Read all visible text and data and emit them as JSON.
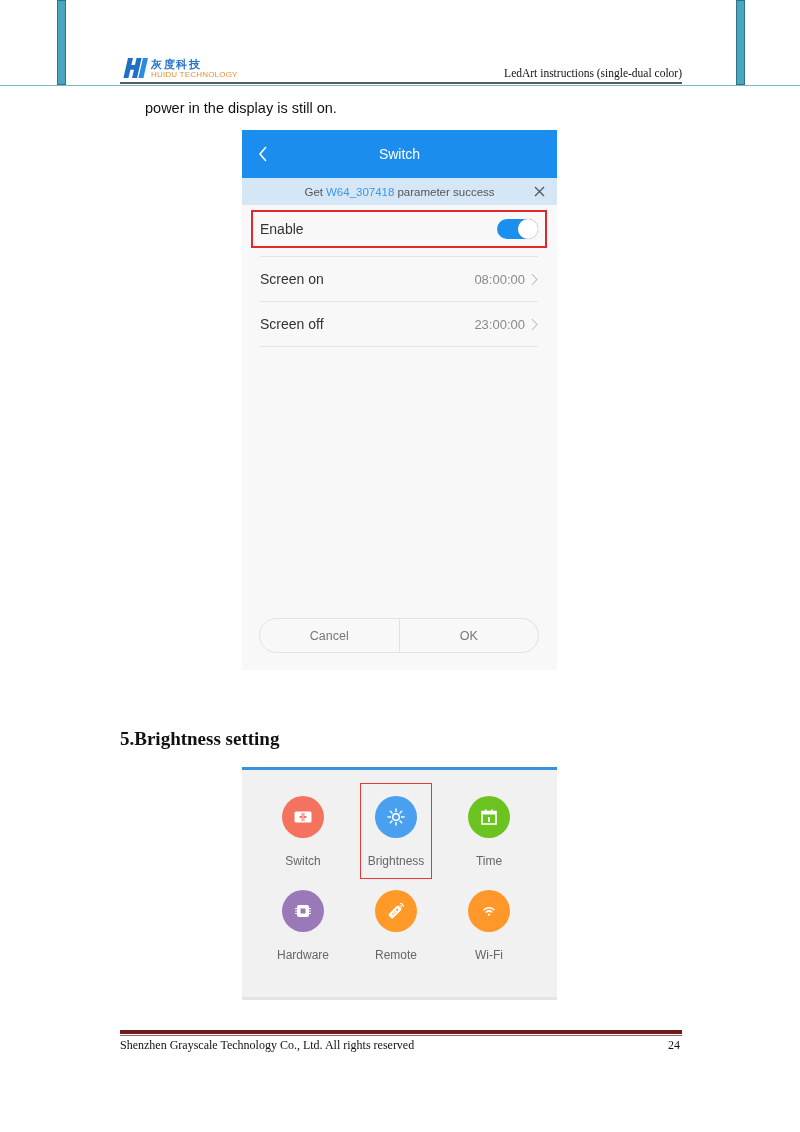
{
  "header": {
    "logo_text": "灰度科技",
    "logo_subtext": "HUIDU TECHNOLOGY",
    "title": "LedArt instructions (single-dual color)"
  },
  "intro_text": "power in the display is still on.",
  "switch_screen": {
    "title": "Switch",
    "notification": {
      "prefix": "Get",
      "device": "W64_307418",
      "suffix": "parameter success"
    },
    "rows": [
      {
        "kind": "toggle",
        "label": "Enable",
        "on": true,
        "highlighted": true
      },
      {
        "kind": "value",
        "label": "Screen on",
        "value": "08:00:00",
        "highlighted": false
      },
      {
        "kind": "value",
        "label": "Screen off",
        "value": "23:00:00",
        "highlighted": false
      }
    ],
    "buttons": [
      {
        "label": "Cancel"
      },
      {
        "label": "OK"
      }
    ]
  },
  "section_heading": "5.Brightness setting",
  "settings_menu": {
    "items": [
      {
        "kind": "switch",
        "label": "Switch",
        "color": "#f4735f",
        "highlighted": false
      },
      {
        "kind": "brightness",
        "label": "Brightness",
        "color": "#4aa0f0",
        "highlighted": true
      },
      {
        "kind": "time",
        "label": "Time",
        "color": "#6cc21e",
        "highlighted": false
      },
      {
        "kind": "hardware",
        "label": "Hardware",
        "color": "#9a79b9",
        "highlighted": false
      },
      {
        "kind": "remote",
        "label": "Remote",
        "color": "#ff9a28",
        "highlighted": false
      },
      {
        "kind": "wifi",
        "label": "Wi-Fi",
        "color": "#ff972b",
        "highlighted": false
      }
    ]
  },
  "footer": {
    "text": "Shenzhen Grayscale Technology Co., Ltd. All rights reserved",
    "page_number": "24"
  }
}
